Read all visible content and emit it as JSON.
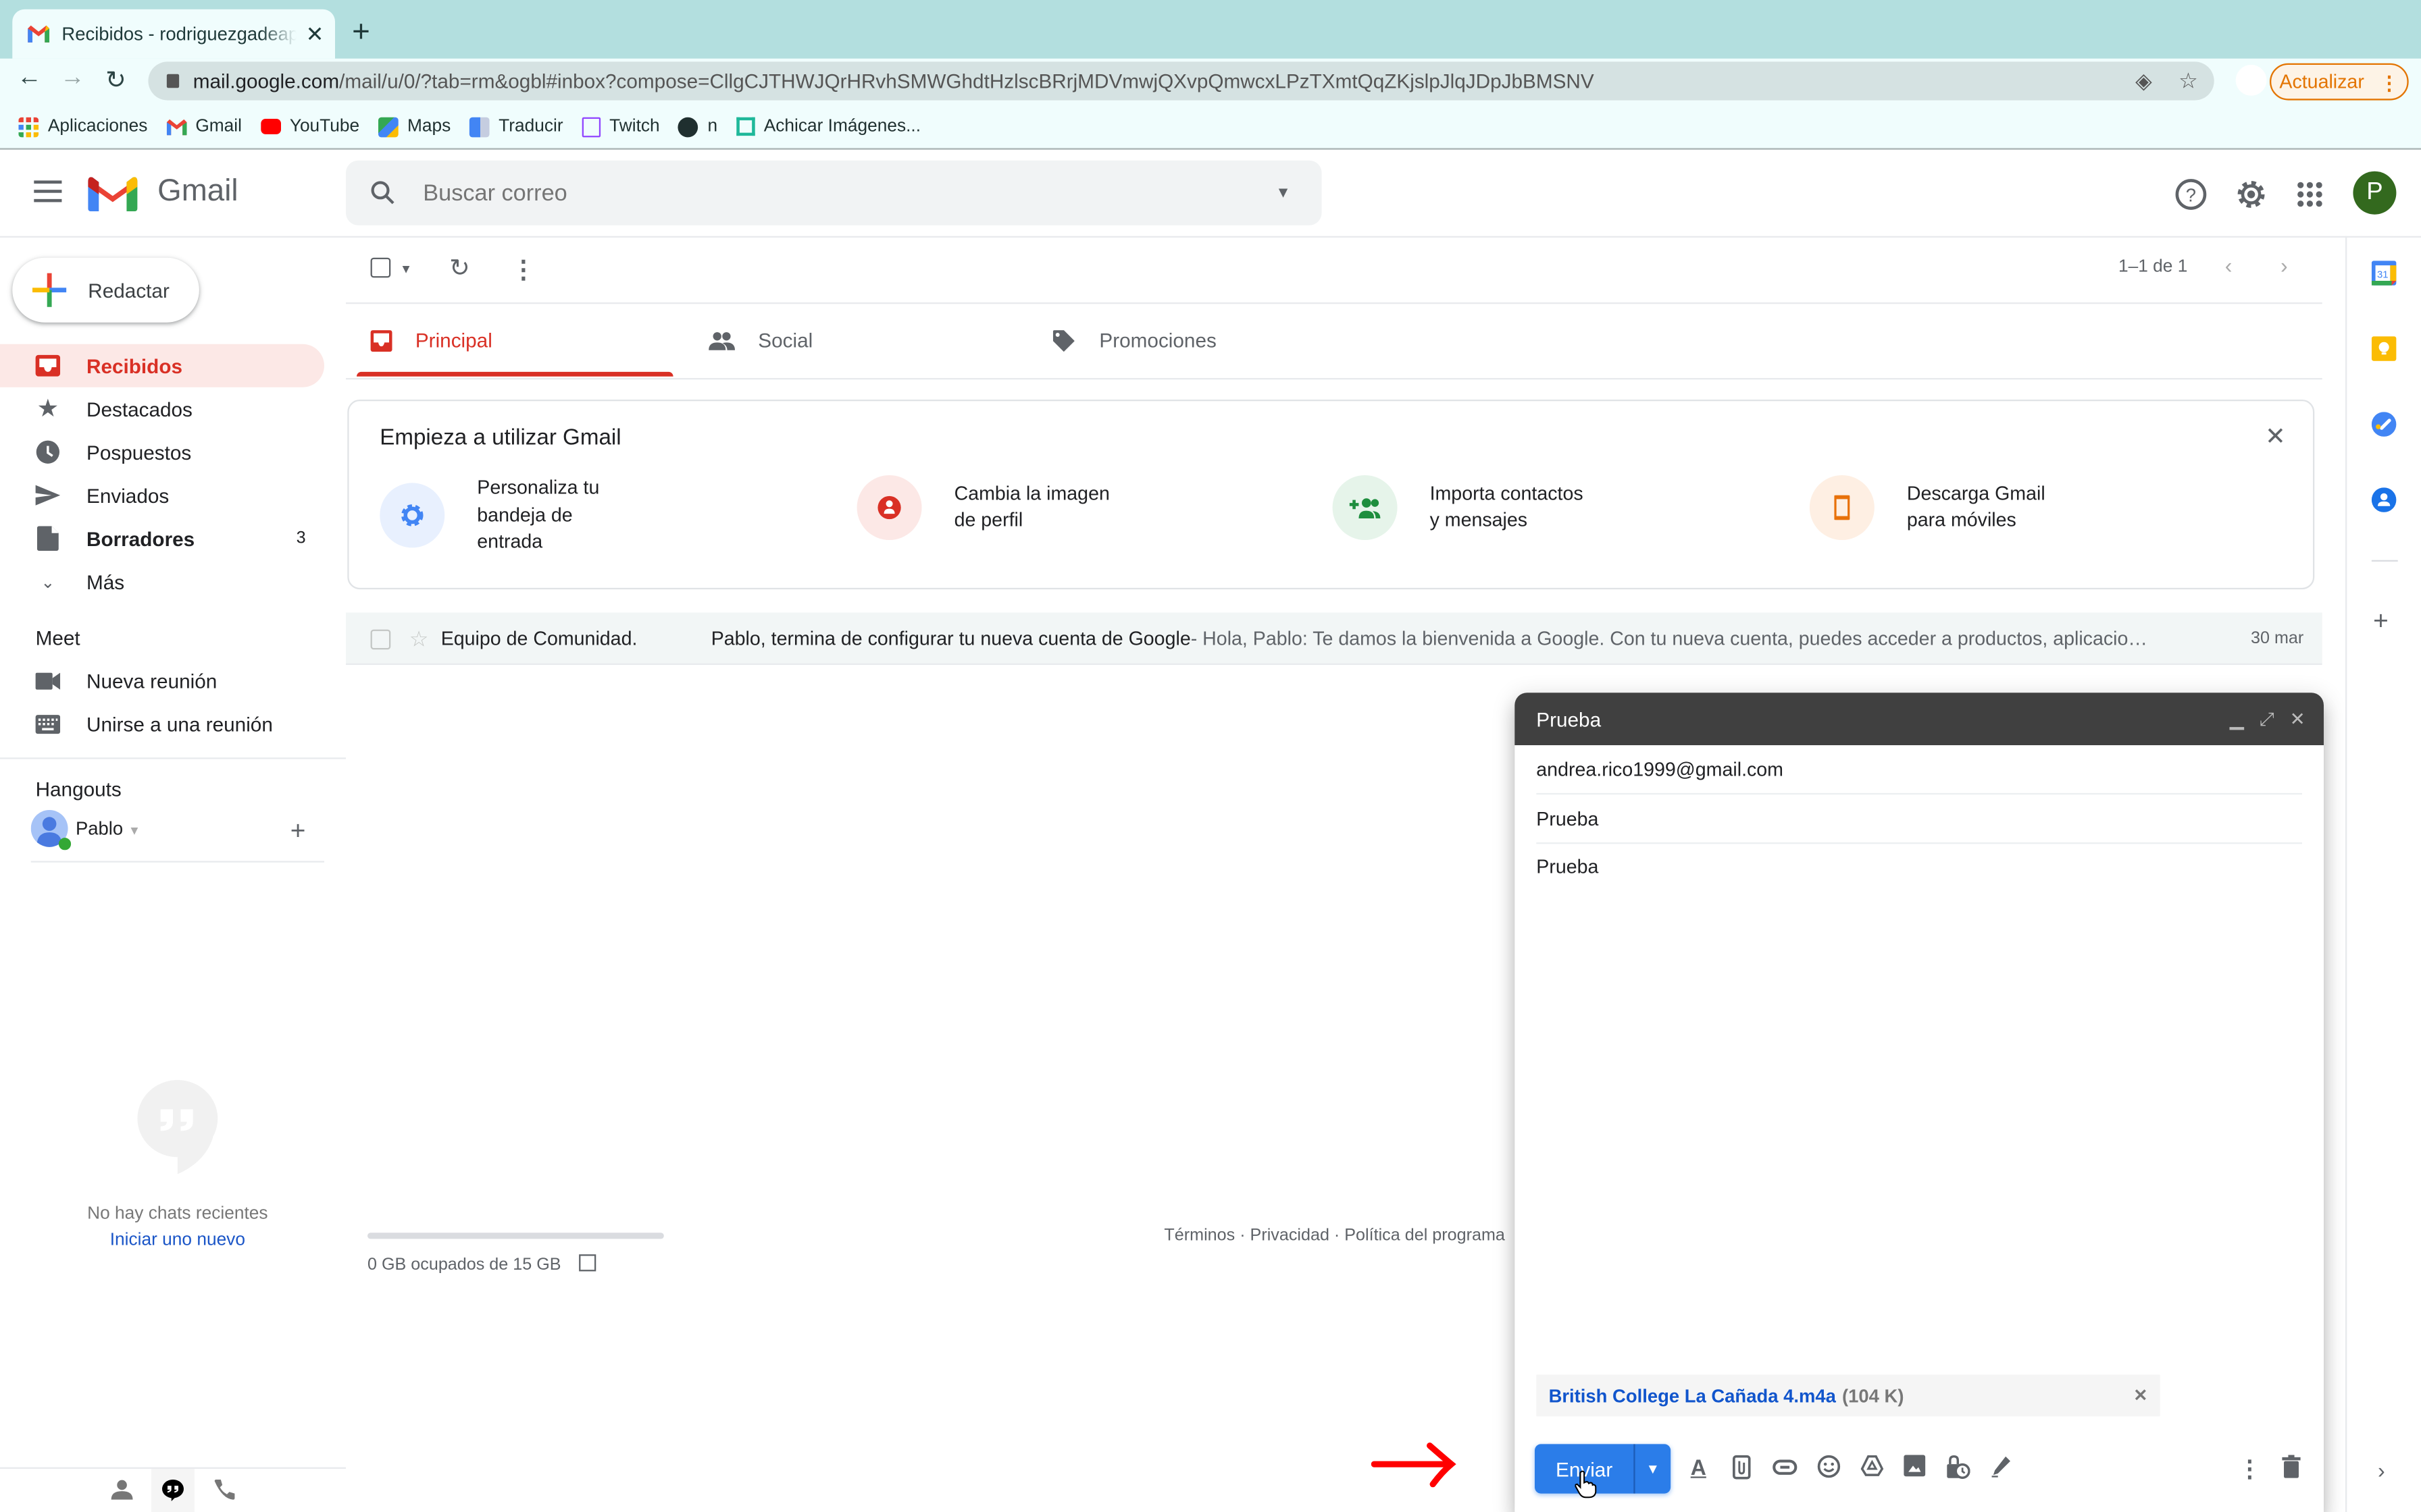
{
  "browser": {
    "tab_title": "Recibidos - rodriguezgadeapab",
    "new_tab_label": "+",
    "url_host": "mail.google.com",
    "url_path": "/mail/u/0/?tab=rm&ogbl#inbox?compose=CllgCJTHWJQrHRvhSMWGhdtHzlscBRrjMDVmwjQXvpQmwcxLPzTXmtQqZKjslpJlqJDpJbBMSNV",
    "update_button": "Actualizar",
    "bookmarks": [
      {
        "label": "Aplicaciones",
        "icon": "apps-grid-icon"
      },
      {
        "label": "Gmail",
        "icon": "gmail-icon"
      },
      {
        "label": "YouTube",
        "icon": "youtube-icon"
      },
      {
        "label": "Maps",
        "icon": "maps-icon"
      },
      {
        "label": "Traducir",
        "icon": "translate-icon"
      },
      {
        "label": "Twitch",
        "icon": "twitch-icon"
      },
      {
        "label": "n",
        "icon": "globe-icon"
      },
      {
        "label": "Achicar Imágenes...",
        "icon": "compress-icon"
      }
    ]
  },
  "header": {
    "app_name": "Gmail",
    "search_placeholder": "Buscar correo",
    "avatar_letter": "P"
  },
  "sidebar": {
    "compose_label": "Redactar",
    "items": [
      {
        "label": "Recibidos",
        "icon": "inbox-icon",
        "active": true,
        "count": ""
      },
      {
        "label": "Destacados",
        "icon": "star-icon",
        "count": ""
      },
      {
        "label": "Pospuestos",
        "icon": "clock-icon",
        "count": ""
      },
      {
        "label": "Enviados",
        "icon": "send-icon",
        "count": ""
      },
      {
        "label": "Borradores",
        "icon": "draft-icon",
        "count": "3",
        "bold": true
      },
      {
        "label": "Más",
        "icon": "chevron-down-icon",
        "count": ""
      }
    ],
    "meet_title": "Meet",
    "meet_items": [
      {
        "label": "Nueva reunión",
        "icon": "video-icon"
      },
      {
        "label": "Unirse a una reunión",
        "icon": "keyboard-icon"
      }
    ],
    "hangouts_title": "Hangouts",
    "hangouts_user": "Pablo",
    "no_chats": "No hay chats recientes",
    "start_new": "Iniciar uno nuevo"
  },
  "main": {
    "pagination": "1–1 de 1",
    "tabs": [
      {
        "label": "Principal",
        "active": true
      },
      {
        "label": "Social"
      },
      {
        "label": "Promociones"
      }
    ],
    "getting_started": {
      "title": "Empieza a utilizar Gmail",
      "items": [
        {
          "line1": "Personaliza tu",
          "line2": "bandeja de",
          "line3": "entrada",
          "color": "#4285f4"
        },
        {
          "line1": "Cambia la imagen",
          "line2": "de perfil",
          "color": "#d93025"
        },
        {
          "line1": "Importa contactos",
          "line2": "y mensajes",
          "color": "#1e8e3e"
        },
        {
          "line1": "Descarga Gmail",
          "line2": "para móviles",
          "color": "#e8710a"
        }
      ]
    },
    "emails": [
      {
        "from": "Equipo de Comunidad.",
        "subject": "Pablo, termina de configurar tu nueva cuenta de Google",
        "snippet": " - Hola, Pablo: Te damos la bienvenida a Google. Con tu nueva cuenta, puedes acceder a productos, aplicacione...",
        "date": "30 mar"
      }
    ],
    "storage": "0 GB ocupados de 15 GB",
    "storage_used_fraction": 0,
    "footer_links": "Términos · Privacidad · Política del programa"
  },
  "compose": {
    "title": "Prueba",
    "to": "andrea.rico1999@gmail.com",
    "subject": "Prueba",
    "body": "Prueba",
    "attachment_name": "British College La Cañada 4.m4a",
    "attachment_size": "(104 K)",
    "send_label": "Enviar"
  },
  "colors": {
    "accent_red": "#d93025",
    "send_blue": "#2b7de9",
    "compose_header": "#404040",
    "update_orange": "#e37400"
  }
}
